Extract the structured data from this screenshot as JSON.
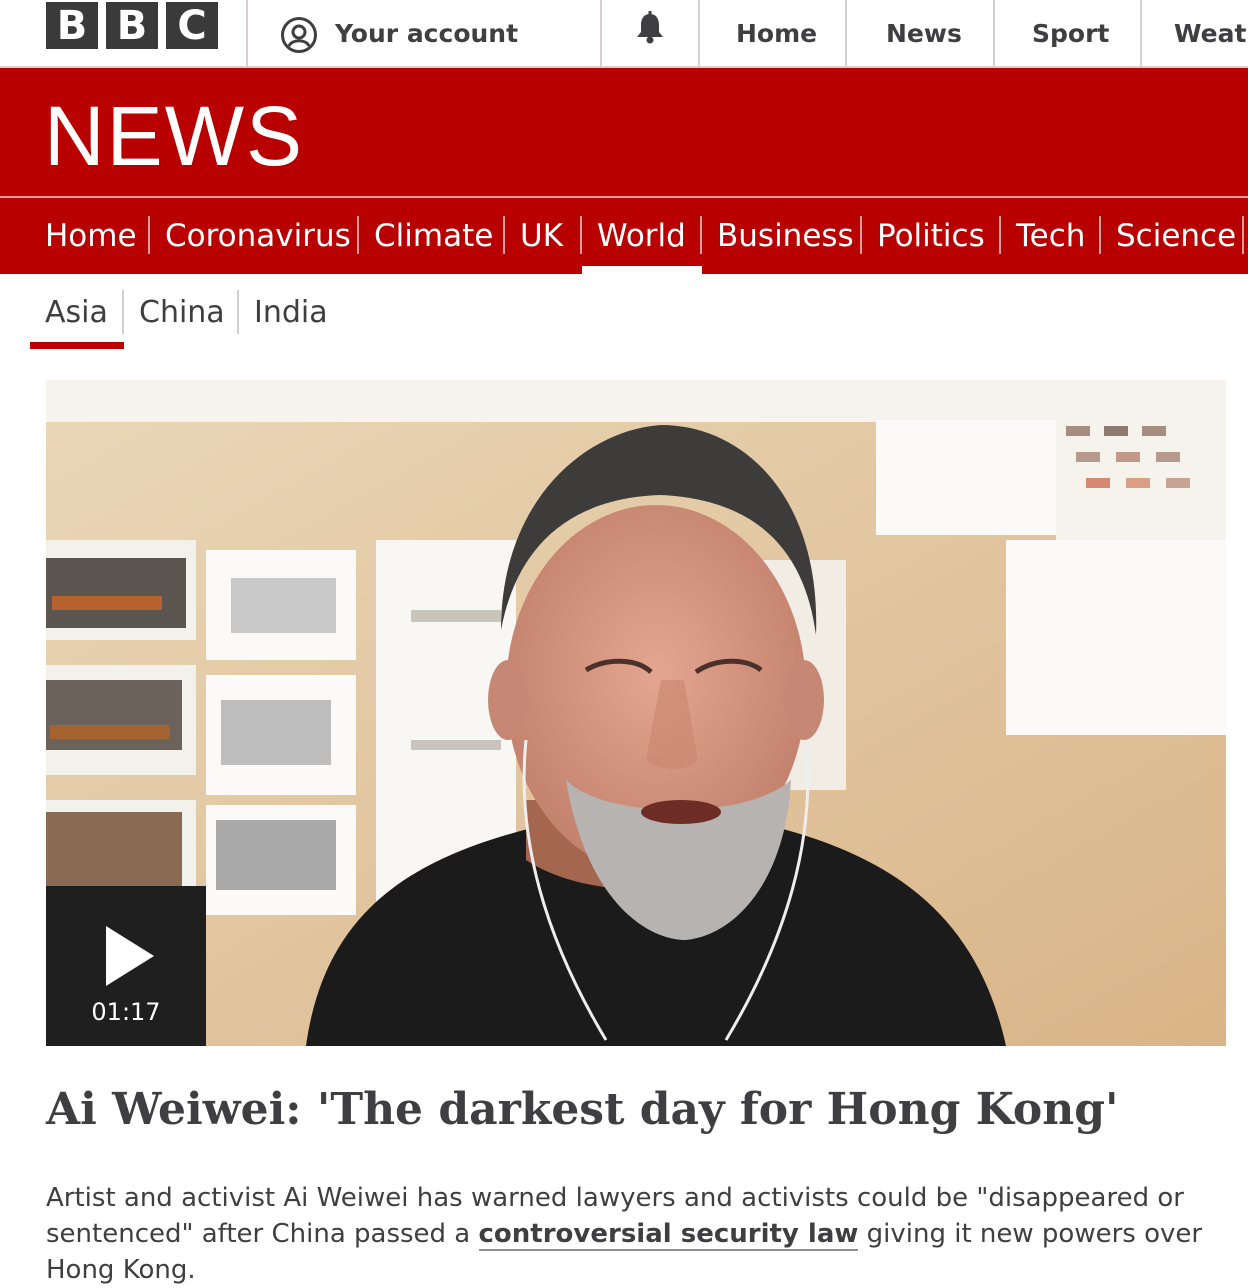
{
  "topbar": {
    "logo_letters": [
      "B",
      "B",
      "C"
    ],
    "account_label": "Your account",
    "account_icon": "user-circle-icon",
    "notification_icon": "bell-icon",
    "nav": [
      "Home",
      "News",
      "Sport",
      "Weath"
    ]
  },
  "header": {
    "title": "NEWS",
    "brand_color": "#b80000"
  },
  "main_nav": {
    "items": [
      "Home",
      "Coronavirus",
      "Climate",
      "UK",
      "World",
      "Business",
      "Politics",
      "Tech",
      "Science"
    ],
    "active": "World"
  },
  "sub_nav": {
    "items": [
      "Asia",
      "China",
      "India"
    ],
    "active": "Asia"
  },
  "video": {
    "duration": "01:17",
    "play_icon": "play-icon"
  },
  "article": {
    "headline": "Ai Weiwei: 'The darkest day for Hong Kong'",
    "summary_before": "Artist and activist Ai Weiwei has warned lawyers and activists could be \"disappeared or sentenced\" after China passed a ",
    "summary_link": "controversial security law",
    "summary_after": " giving it new powers over Hong Kong."
  }
}
